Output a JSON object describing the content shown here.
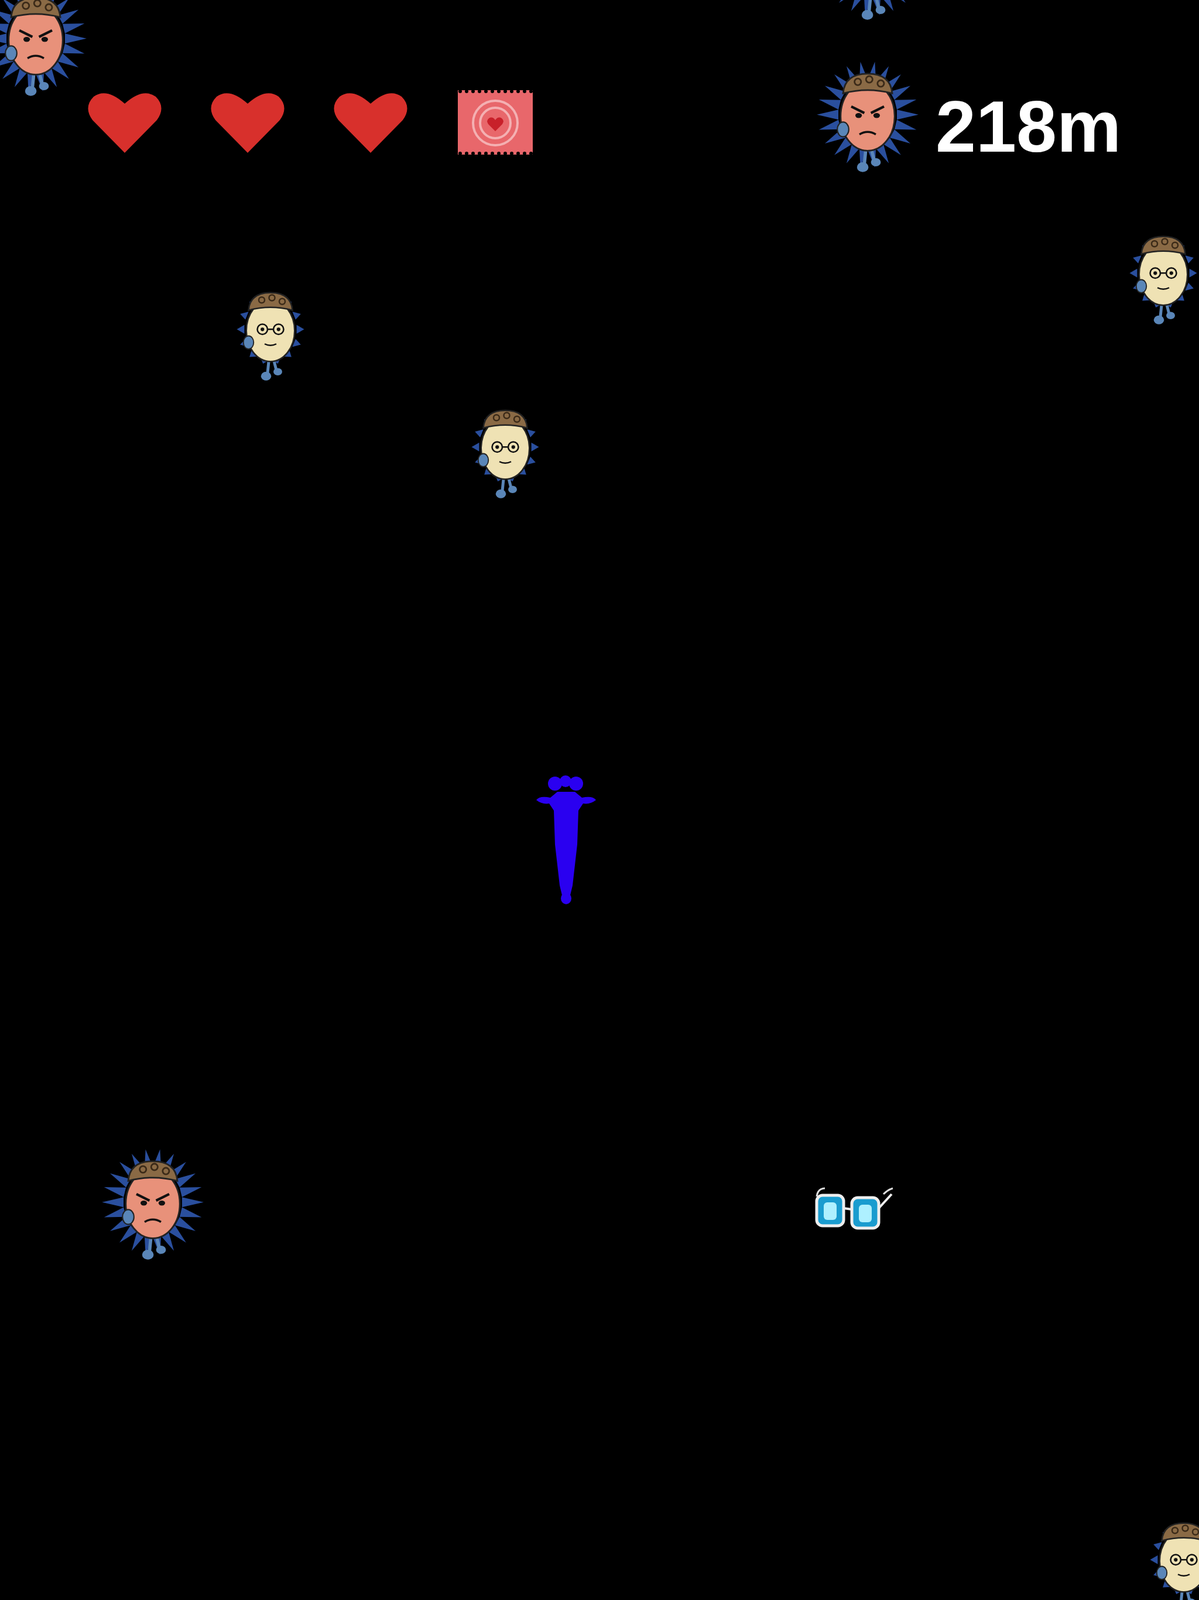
{
  "hud": {
    "hearts": [
      {
        "filled": true
      },
      {
        "filled": true
      },
      {
        "filled": true
      }
    ],
    "distance": "218m"
  },
  "enemies": [
    {
      "kind": "angry"
    },
    {
      "kind": "angry"
    },
    {
      "kind": "angry"
    },
    {
      "kind": "calm"
    },
    {
      "kind": "calm"
    },
    {
      "kind": "calm"
    },
    {
      "kind": "angry"
    },
    {
      "kind": "calm"
    }
  ],
  "pickups": [
    {
      "kind": "glasses"
    }
  ]
}
